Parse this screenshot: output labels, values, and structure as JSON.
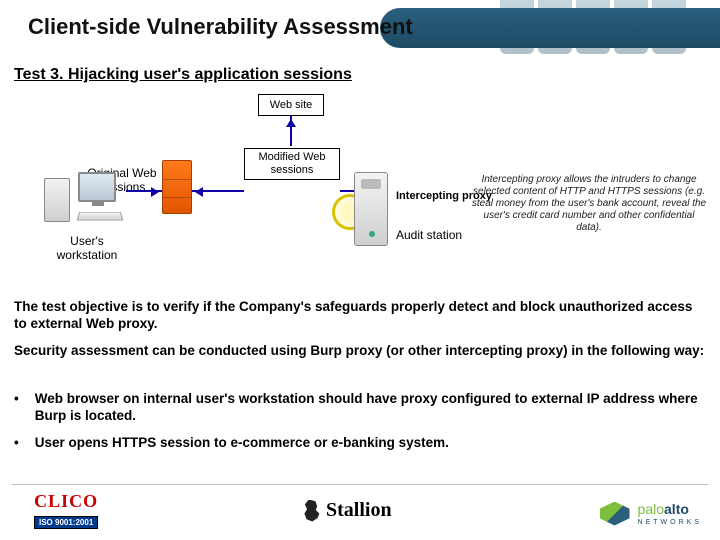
{
  "title": "Client-side Vulnerability Assessment",
  "subtitle": "Test 3. Hijacking user's application sessions",
  "diagram": {
    "website": "Web site",
    "modified": "Modified Web sessions",
    "original": "Original Web sessions",
    "user_ws": "User's workstation",
    "proxy": "Intercepting proxy",
    "audit": "Audit station",
    "caption": "Intercepting proxy allows the intruders to change selected content of HTTP and HTTPS sessions (e.g. steal money from the user's bank account, reveal the user's credit card number and other confidential data)."
  },
  "paragraphs": {
    "p1": "The test objective is to verify if the Company's safeguards properly detect and block unauthorized access to external Web proxy.",
    "p2": "Security assessment can be conducted using Burp proxy (or other intercepting proxy) in the following way:"
  },
  "bullets": {
    "b1": "Web browser on internal user's workstation should have proxy configured to external IP address where Burp is located.",
    "b2": "User opens HTTPS session to e-commerce or e-banking system."
  },
  "footer": {
    "clico": "CLICO",
    "iso": "ISO 9001:2001",
    "stallion": "Stallion",
    "pan_a": "palo",
    "pan_b": "alto",
    "pan_c": "NETWORKS"
  }
}
